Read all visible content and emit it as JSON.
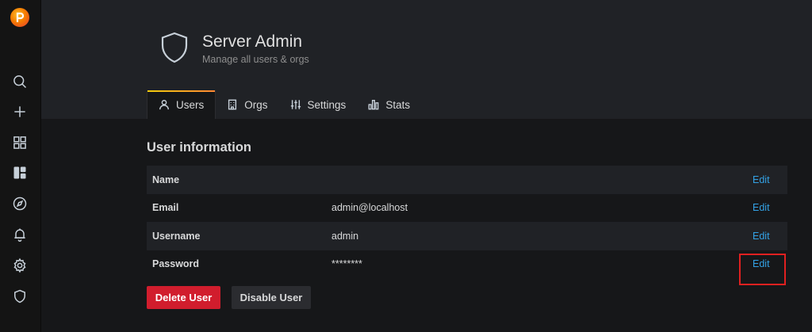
{
  "sidebar": {
    "items": [
      {
        "icon": "search-icon"
      },
      {
        "icon": "plus-icon"
      },
      {
        "icon": "dashboards-icon"
      },
      {
        "icon": "apps-icon"
      },
      {
        "icon": "compass-icon"
      },
      {
        "icon": "bell-icon"
      },
      {
        "icon": "gear-icon"
      },
      {
        "icon": "shield-icon"
      }
    ]
  },
  "header": {
    "title": "Server Admin",
    "subtitle": "Manage all users & orgs"
  },
  "tabs": [
    {
      "label": "Users",
      "icon": "user-icon",
      "active": true
    },
    {
      "label": "Orgs",
      "icon": "building-icon",
      "active": false
    },
    {
      "label": "Settings",
      "icon": "sliders-icon",
      "active": false
    },
    {
      "label": "Stats",
      "icon": "bar-chart-icon",
      "active": false
    }
  ],
  "user_info": {
    "title": "User information",
    "edit_label": "Edit",
    "rows": [
      {
        "label": "Name",
        "value": ""
      },
      {
        "label": "Email",
        "value": "admin@localhost"
      },
      {
        "label": "Username",
        "value": "admin"
      },
      {
        "label": "Password",
        "value": "********"
      }
    ]
  },
  "actions": {
    "delete_label": "Delete User",
    "disable_label": "Disable User"
  },
  "colors": {
    "accent_link": "#33a2e5",
    "danger": "#d11d2d",
    "highlight": "#e02020"
  }
}
